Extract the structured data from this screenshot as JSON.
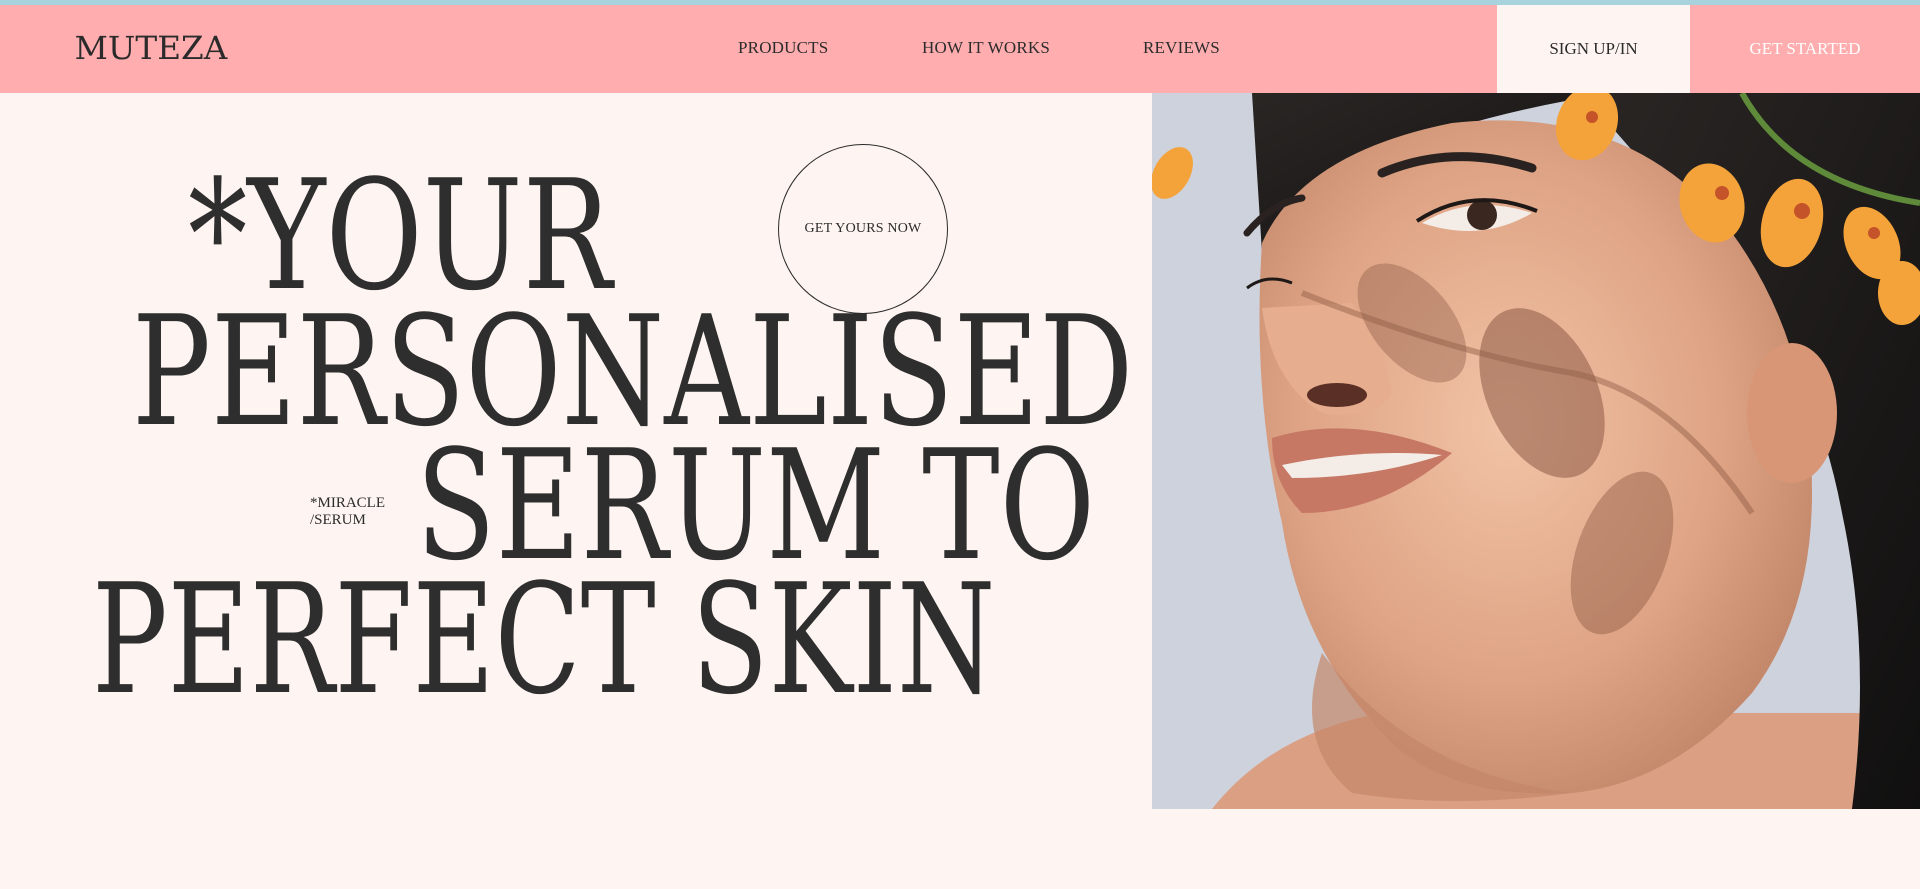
{
  "brand": {
    "logo": "MUTEZA",
    "accent": "#ffadae",
    "background": "#fef5f2",
    "text_color": "#2b2b2b"
  },
  "nav": {
    "links": [
      "PRODUCTS",
      "HOW IT WORKS",
      "REVIEWS"
    ],
    "signin_label": "SIGN UP/IN",
    "cta_label": "GET STARTED"
  },
  "hero": {
    "headline": [
      "*YOUR",
      "PERSONALISED",
      "SERUM TO",
      "PERFECT SKIN"
    ],
    "circle_cta": "GET YOURS NOW",
    "tag_line1": "*MIRACLE",
    "tag_line2": "/SERUM",
    "image_alt": "woman with orange orchid flowers and leaf shadows on face"
  }
}
